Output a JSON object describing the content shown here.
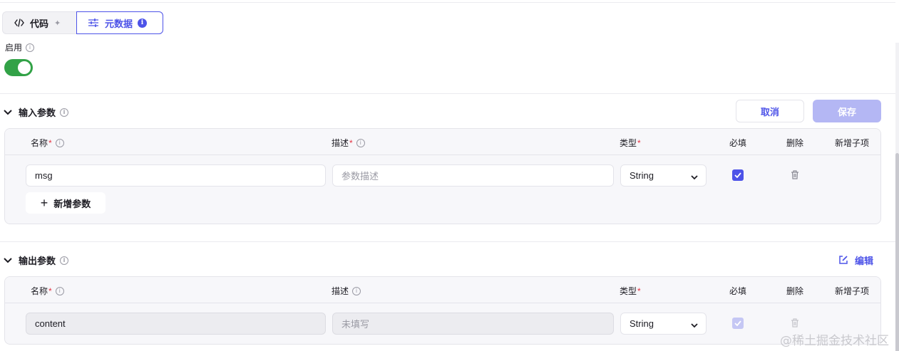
{
  "tabs": [
    {
      "label": "代码",
      "icon": "code-icon"
    },
    {
      "label": "元数据",
      "icon": "sliders-icon"
    }
  ],
  "enabled": {
    "label": "启用",
    "on": true
  },
  "input_section": {
    "title": "输入参数",
    "cancel_label": "取消",
    "save_label": "保存",
    "columns": {
      "name": "名称",
      "desc": "描述",
      "type": "类型",
      "required": "必填",
      "delete": "删除",
      "add_child": "新增子项"
    },
    "rows": [
      {
        "name": "msg",
        "desc_placeholder": "参数描述",
        "type": "String",
        "required": true
      }
    ],
    "add_label": "新增参数"
  },
  "output_section": {
    "title": "输出参数",
    "edit_label": "编辑",
    "columns": {
      "name": "名称",
      "desc": "描述",
      "type": "类型",
      "required": "必填",
      "delete": "删除",
      "add_child": "新增子项"
    },
    "rows": [
      {
        "name": "content",
        "desc_placeholder": "未填写",
        "type": "String",
        "required": true
      }
    ]
  },
  "watermark": "@稀土掘金技术社区",
  "colors": {
    "accent": "#4d53e8",
    "toggle_on": "#32a247",
    "required_star": "#e53241",
    "save_disabled": "#b4b7f4"
  }
}
